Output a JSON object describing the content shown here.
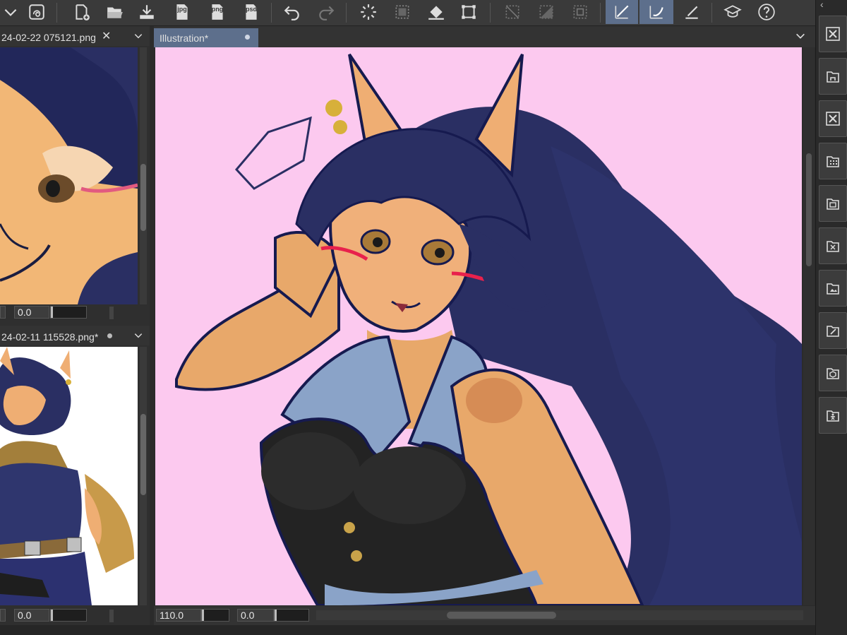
{
  "toolbar": {
    "buttons": [
      {
        "icon": "chevron-down-icon"
      },
      {
        "icon": "layer-effect-icon"
      },
      {
        "icon": "new-file-icon"
      },
      {
        "icon": "open-folder-icon"
      },
      {
        "icon": "save-icon"
      },
      {
        "icon": "export-jpg-icon",
        "label": "jpg"
      },
      {
        "icon": "export-png-icon",
        "label": "png"
      },
      {
        "icon": "export-psd-icon",
        "label": "psd"
      },
      {
        "icon": "undo-icon"
      },
      {
        "icon": "redo-icon"
      },
      {
        "icon": "loading-spinner-icon"
      },
      {
        "icon": "select-all-icon"
      },
      {
        "icon": "fill-bucket-icon"
      },
      {
        "icon": "transform-icon"
      },
      {
        "icon": "clear-selection-icon"
      },
      {
        "icon": "invert-selection-icon"
      },
      {
        "icon": "selection-border-icon"
      },
      {
        "icon": "line-pen-icon"
      },
      {
        "icon": "curve-pen-icon"
      },
      {
        "icon": "ruler-pen-icon"
      },
      {
        "icon": "learning-icon"
      },
      {
        "icon": "help-icon"
      }
    ]
  },
  "sub_panels": [
    {
      "tab_title": "24-02-22 075121.png",
      "rotation_value": "0.0"
    },
    {
      "tab_title": "24-02-11 115528.png*",
      "rotation_value": "0.0"
    }
  ],
  "main": {
    "tab_title": "Illustration*",
    "zoom_value": "110.0",
    "rotation_value": "0.0"
  },
  "dock": {
    "icons": [
      "close-panel-icon",
      "home-panel-icon",
      "close-panel-icon",
      "grid-panel-icon",
      "layout-panel-icon",
      "transform-panel-icon",
      "image-panel-icon",
      "edit-panel-icon",
      "3d-panel-icon",
      "figure-panel-icon"
    ]
  },
  "colors": {
    "canvas_bg": "#fcc9ef",
    "hair": "#2a2f63",
    "skin": "#e8a86a",
    "outline": "#161a4f",
    "vest": "#232323",
    "collar": "#8aa3c8",
    "accent": "#5d6f8c"
  }
}
